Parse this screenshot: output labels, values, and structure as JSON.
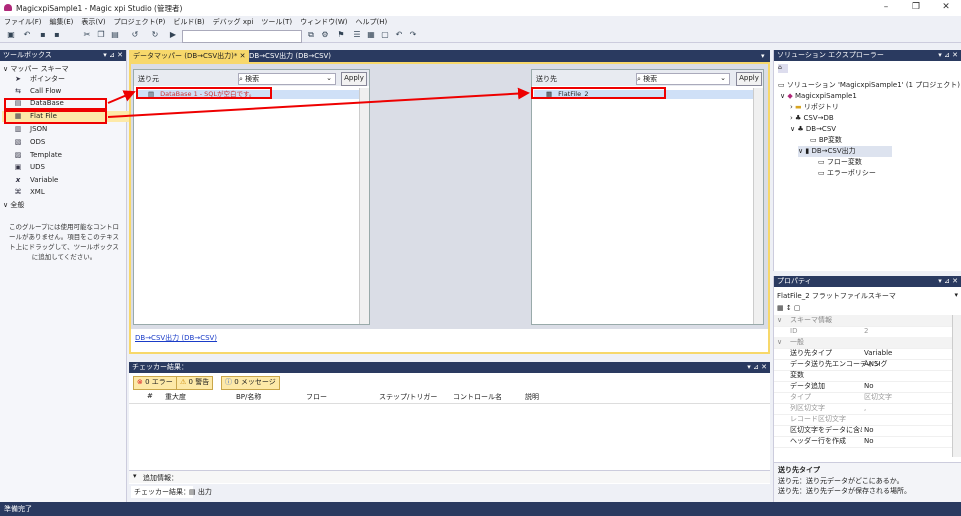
{
  "titlebar": {
    "title": "MagicxpiSample1 - Magic xpi Studio (管理者)"
  },
  "menu": [
    "ファイル(F)",
    "編集(E)",
    "表示(V)",
    "プロジェクト(P)",
    "ビルド(B)",
    "デバッグ xpi",
    "ツール(T)",
    "ウィンドウ(W)",
    "ヘルプ(H)"
  ],
  "toolbox": {
    "title": "ツールボックス",
    "group1": "マッパー スキーマ",
    "items": [
      {
        "label": "ポインター",
        "icon": "pointer-icon"
      },
      {
        "label": "Call Flow",
        "icon": "callflow-icon"
      },
      {
        "label": "DataBase",
        "icon": "database-icon"
      },
      {
        "label": "Flat File",
        "icon": "flatfile-icon"
      },
      {
        "label": "JSON",
        "icon": "json-icon"
      },
      {
        "label": "ODS",
        "icon": "ods-icon"
      },
      {
        "label": "Template",
        "icon": "template-icon"
      },
      {
        "label": "UDS",
        "icon": "uds-icon"
      },
      {
        "label": "Variable",
        "icon": "variable-icon"
      },
      {
        "label": "XML",
        "icon": "xml-icon"
      }
    ],
    "group2": "全般",
    "empty_text": "このグループには使用可能なコントロールがありません。項目をこのテキスト上にドラッグして、ツールボックスに追加してください。"
  },
  "doc_tabs": [
    {
      "label": "データマッパー (DB→CSV出力)*",
      "active": true
    },
    {
      "label": "DB→CSV出力 (DB→CSV)",
      "active": false
    }
  ],
  "mapper": {
    "source": {
      "label": "送り元",
      "search_placeholder": "検索",
      "apply": "Apply",
      "row": "DataBase 1 - SQLが空白です。"
    },
    "dest": {
      "label": "送り先",
      "search_placeholder": "検索",
      "apply": "Apply",
      "row": "FlatFile_2"
    },
    "breadcrumb": "DB→CSV出力 (DB→CSV)"
  },
  "solution": {
    "title": "ソリューション エクスプローラー",
    "root": "ソリューション 'MagicxpiSample1' (1 プロジェクト)",
    "project": "MagicxpiSample1",
    "items": [
      {
        "label": "リポジトリ",
        "indent": 1
      },
      {
        "label": "CSV→DB",
        "indent": 1
      },
      {
        "label": "DB→CSV",
        "indent": 1
      },
      {
        "label": "BP変数",
        "indent": 2
      },
      {
        "label": "DB→CSV出力",
        "indent": 2
      },
      {
        "label": "フロー変数",
        "indent": 3
      },
      {
        "label": "エラーポリシー",
        "indent": 3
      }
    ]
  },
  "props": {
    "title": "プロパティ",
    "object": "FlatFile_2 フラットファイルスキーマ",
    "rows": [
      {
        "k": "スキーマ情報",
        "v": "",
        "sec": true
      },
      {
        "k": "ID",
        "v": "2",
        "grey": true
      },
      {
        "k": "一般",
        "v": "",
        "sec": true
      },
      {
        "k": "送り先タイプ",
        "v": "Variable"
      },
      {
        "k": "データ送り先エンコーディング",
        "v": "ANSI"
      },
      {
        "k": "変数",
        "v": ""
      },
      {
        "k": "データ追加",
        "v": "No"
      },
      {
        "k": "タイプ",
        "v": "区切文字",
        "grey": true
      },
      {
        "k": "列区切文字",
        "v": ",",
        "grey": true
      },
      {
        "k": "レコード区切文字",
        "v": "",
        "grey": true
      },
      {
        "k": "区切文字をデータに含める",
        "v": "No"
      },
      {
        "k": "ヘッダー行を作成",
        "v": "No"
      }
    ],
    "desc_title": "送り先タイプ",
    "desc_lines": [
      "送り元：送り元データがどこにあるか。",
      "送り先：送り先データが保存される場所。"
    ]
  },
  "checker": {
    "title": "チェッカー結果：",
    "errors": "0 エラー",
    "warnings": "0 警告",
    "messages": "0 メッセージ",
    "columns": [
      "#",
      "重大度",
      "BP/名称",
      "フロー",
      "ステップ/トリガー",
      "コントロール名",
      "説明"
    ],
    "extra": "追加情報：",
    "bottom_tabs": [
      "チェッカー結果：",
      "出力"
    ]
  },
  "status": "準備完了"
}
